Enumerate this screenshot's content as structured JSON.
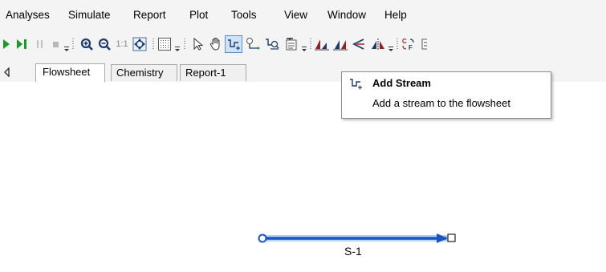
{
  "menu": {
    "items": [
      "Analyses",
      "Simulate",
      "Report",
      "Plot",
      "Tools",
      "View",
      "Window",
      "Help"
    ]
  },
  "toolbar": {
    "zoom_1to1_label": "1:1",
    "active_tool": "add-stream",
    "accent_color": "#1a55c8"
  },
  "tabs": [
    {
      "label": "Flowsheet",
      "active": true
    },
    {
      "label": "Chemistry",
      "active": false
    },
    {
      "label": "Report-1",
      "active": false
    }
  ],
  "tooltip": {
    "title": "Add Stream",
    "description": "Add a stream to the flowsheet"
  },
  "flowsheet": {
    "stream": {
      "label": "S-1",
      "color": "#1a55c8"
    }
  }
}
